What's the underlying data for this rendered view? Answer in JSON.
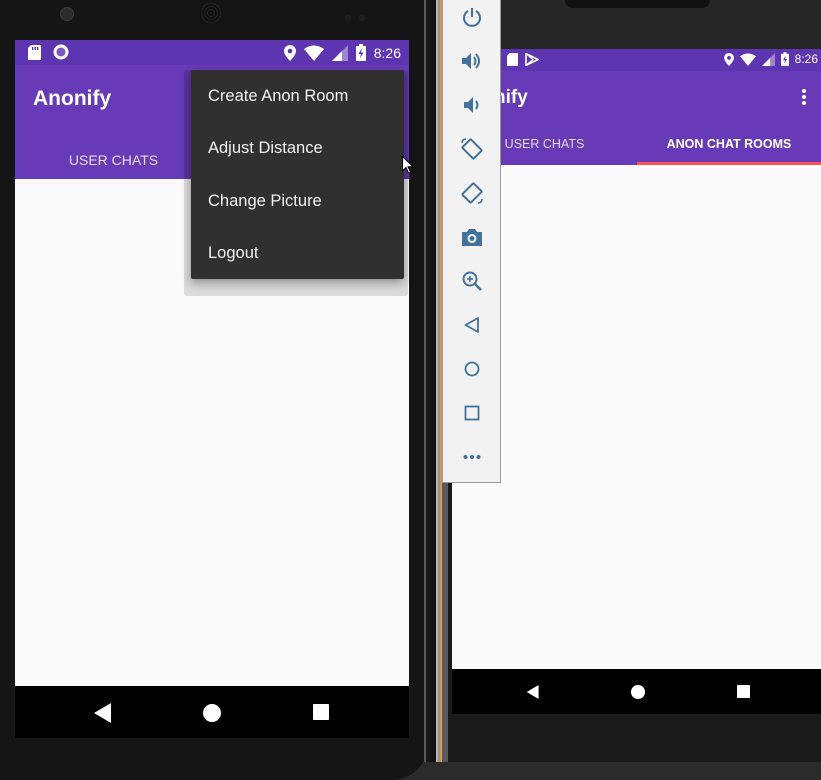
{
  "phone1": {
    "status_time": "8:26",
    "app_title": "Anonify",
    "tabs": [
      "USER CHATS"
    ],
    "menu": {
      "items": [
        "Create Anon Room",
        "Adjust Distance",
        "Change Picture",
        "Logout"
      ]
    }
  },
  "phone2": {
    "status_time": "8:26",
    "app_title": "nify",
    "tabs": [
      "USER CHATS",
      "ANON CHAT ROOMS"
    ],
    "selected_tab": "ANON CHAT ROOMS"
  },
  "toolbar": {
    "buttons": [
      "power-icon",
      "volume-up-icon",
      "volume-down-icon",
      "rotate-left-icon",
      "rotate-right-icon",
      "camera-icon",
      "zoom-icon",
      "back-icon",
      "home-icon",
      "overview-icon",
      "more-icon"
    ]
  },
  "colors": {
    "primary": "#673ab7",
    "primary_dark": "#5e35b1",
    "menu_bg": "#303030",
    "tab_indicator": "#ff5252",
    "toolbar_icon": "#42729c"
  }
}
